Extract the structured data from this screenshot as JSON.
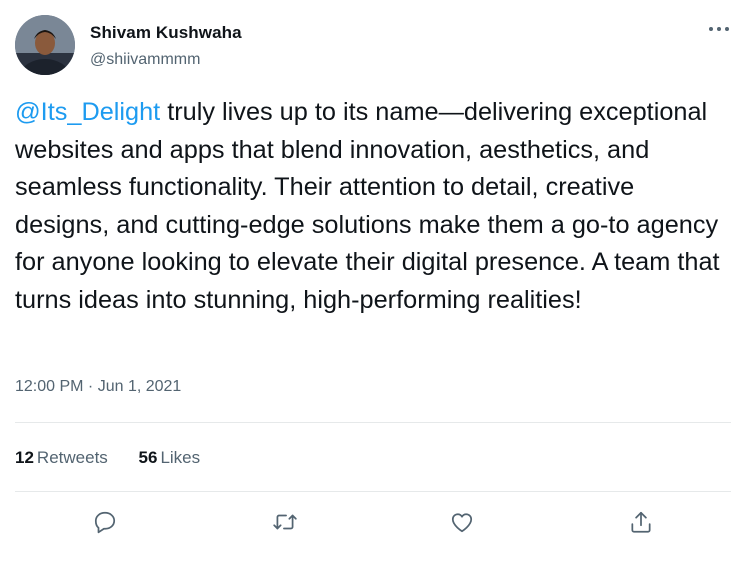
{
  "author": {
    "name": "Shivam Kushwaha",
    "handle": "@shiivammmm"
  },
  "tweet": {
    "mention": "@Its_Delight",
    "text": " truly lives up to its name—delivering exceptional websites and apps that blend innovation, aesthetics, and seamless functionality. Their attention to detail, creative designs, and cutting-edge solutions make them a go-to agency for anyone looking to elevate their digital presence. A team that turns ideas into stunning, high-performing realities!",
    "time": "12:00 PM · Jun 1, 2021"
  },
  "stats": {
    "retweets_count": "12",
    "retweets_label": "Retweets",
    "likes_count": "56",
    "likes_label": "Likes"
  },
  "actions": [
    "reply-icon",
    "retweet-icon",
    "like-icon",
    "share-icon"
  ],
  "colors": {
    "link": "#1d9bf0",
    "secondary_text": "#536471",
    "primary_text": "#0f1419",
    "divider": "#e6e9ea"
  }
}
